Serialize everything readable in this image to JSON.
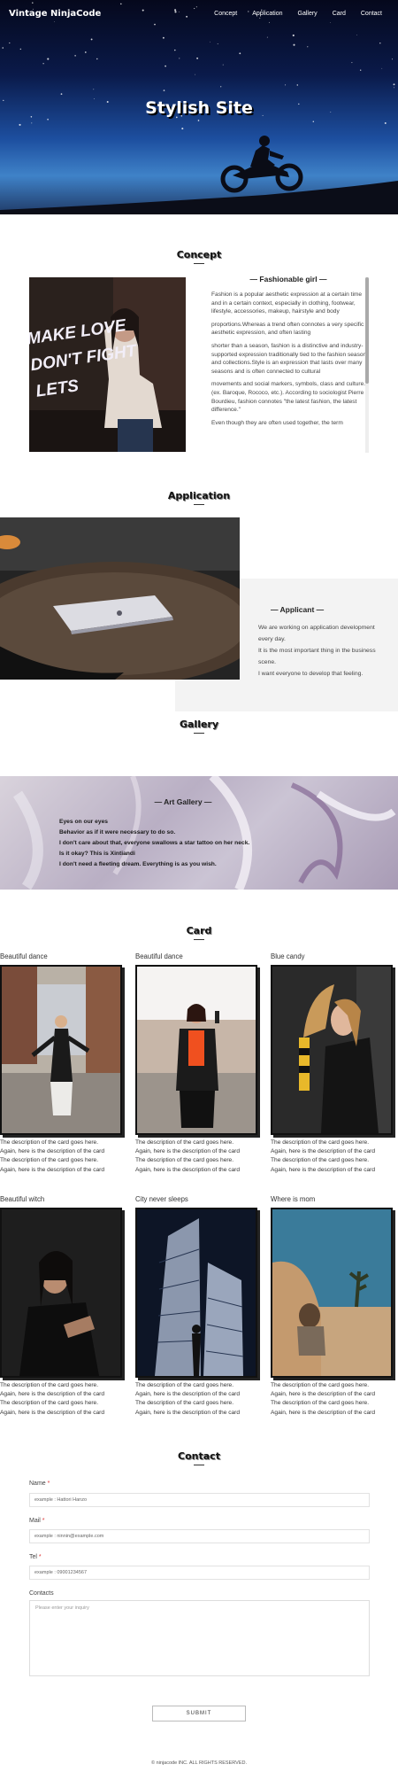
{
  "header": {
    "logo": "Vintage NinjaCode",
    "nav": [
      "Concept",
      "Application",
      "Gallery",
      "Card",
      "Contact"
    ],
    "hero_title": "Stylish Site"
  },
  "concept": {
    "title": "Concept",
    "subheading": "— Fashionable girl —",
    "paragraphs": [
      "Fashion is a popular aesthetic expression at a certain time and in a certain context, especially in clothing, footwear, lifestyle, accessories, makeup, hairstyle and body",
      "proportions.Whereas a trend often connotes a very specific aesthetic expression, and often lasting",
      "shorter than a season, fashion is a distinctive and industry-supported expression traditionally tied to the fashion season and collections.Style is an expression that lasts over many seasons and is often connected to cultural",
      "movements and social markers, symbols, class and culture.(ex. Baroque, Rococo, etc.). According to sociologist Pierre Bourdieu, fashion connotes \"the latest fashion, the latest difference.\"",
      "Even though they are often used together, the term"
    ],
    "neon_text": [
      "MAKE LOVE",
      "DON'T FIGHT",
      "LETS"
    ]
  },
  "application": {
    "title": "Application",
    "subheading": "— Applicant —",
    "lines": [
      "We are working on application development every day.",
      "It is the most important thing in the business scene.",
      "I want everyone to develop that feeling."
    ]
  },
  "gallery": {
    "title": "Gallery",
    "subheading": "— Art Gallery —",
    "lines": [
      "Eyes on our eyes",
      "Behavior as if it were necessary to do so.",
      "I don't care about that, everyone swallows a star tattoo on her neck.",
      "Is it okay? This is Xintiandi",
      "I don't need a fleeting dream. Everything is as you wish."
    ]
  },
  "cards": {
    "title": "Card",
    "items": [
      {
        "title": "Beautiful dance",
        "desc": [
          "The description of the card goes here.",
          "Again, here is the description of the card",
          "The description of the card goes here.",
          "Again, here is the description of the card"
        ]
      },
      {
        "title": "Beautiful dance",
        "desc": [
          "The description of the card goes here.",
          "Again, here is the description of the card",
          "The description of the card goes here.",
          "Again, here is the description of the card"
        ]
      },
      {
        "title": "Blue candy",
        "desc": [
          "The description of the card goes here.",
          "Again, here is the description of the card",
          "The description of the card goes here.",
          "Again, here is the description of the card"
        ]
      },
      {
        "title": "Beautiful witch",
        "desc": [
          "The description of the card goes here.",
          "Again, here is the description of the card",
          "The description of the card goes here.",
          "Again, here is the description of the card"
        ]
      },
      {
        "title": "City never sleeps",
        "desc": [
          "The description of the card goes here.",
          "Again, here is the description of the card",
          "The description of the card goes here.",
          "Again, here is the description of the card"
        ]
      },
      {
        "title": "Where is mom",
        "desc": [
          "The description of the card goes here.",
          "Again, here is the description of the card",
          "The description of the card goes here.",
          "Again, here is the description of the card"
        ]
      }
    ]
  },
  "contact": {
    "title": "Contact",
    "name_label": "Name",
    "name_placeholder": "example : Hattori Hanzo",
    "mail_label": "Mail",
    "mail_placeholder": "example : ninnin@example.com",
    "tel_label": "Tel",
    "tel_placeholder": "example : 09001234567",
    "contacts_label": "Contacts",
    "contacts_placeholder": "Please enter your inquiry",
    "required_mark": "*",
    "submit": "SUBMIT"
  },
  "footer": "© ninjacode INC. ALL RIGHTS RESERVED.",
  "colors": {
    "accent_required": "#dd3333",
    "hero_sky": "#1d4fa0"
  }
}
